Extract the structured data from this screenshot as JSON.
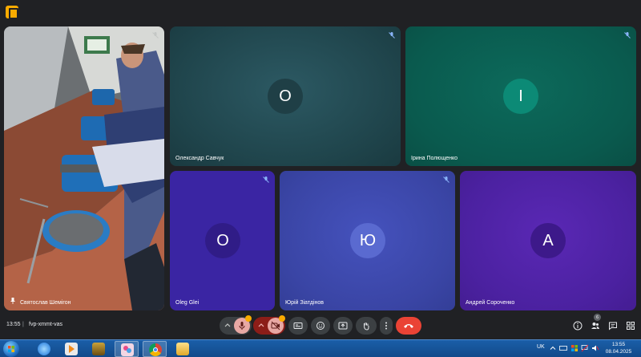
{
  "participants": {
    "sviatoslav": "Святослав Шемігон",
    "savchuk": "Олександр Савчук",
    "iryna": "Ірина Полющенко",
    "oleg": "Oleg Glei",
    "yuriy": "Юрій Зіатдінов",
    "andriy": "Андрей Сороченко"
  },
  "avatars": {
    "savchuk": "О",
    "iryna": "І",
    "oleg": "О",
    "yuriy": "Ю",
    "andriy": "А"
  },
  "avatar_colors": {
    "savchuk": "#1f3f46",
    "iryna": "#0c8a76",
    "oleg": "#301c87",
    "yuriy": "#5a6ad0",
    "andriy": "#3d198a"
  },
  "meeting": {
    "time": "13:55",
    "separator": "|",
    "code": "fvp-xmmt-vas"
  },
  "people_count": "6",
  "taskbar": {
    "language": "UK",
    "clock_time": "13:55",
    "clock_date": "08.04.2025",
    "apps": [
      "windows-explorer",
      "internet-explorer",
      "media-player",
      "game-app",
      "paint-app",
      "chrome",
      "file-explorer"
    ]
  },
  "colors": {
    "meet_bg": "#202124",
    "end_call": "#ea4335",
    "control_bg": "#3c4043",
    "mic_muted": "#8c1d18"
  }
}
